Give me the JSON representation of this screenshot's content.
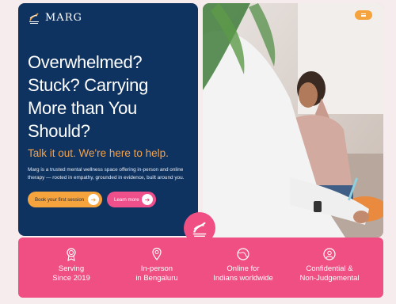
{
  "brand": {
    "name": "MARG"
  },
  "hero": {
    "headline": "Overwhelmed? Stuck? Carrying More than You Should?",
    "tagline": "Talk it out. We're here to help.",
    "description": "Marg is a trusted mental wellness space offering in-person and online therapy — rooted in empathy, grounded in evidence, built around you.",
    "primary_cta": "Book your first session",
    "secondary_cta": "Learn more"
  },
  "features": [
    {
      "icon": "award-ribbon-icon",
      "line1": "Serving",
      "line2": "Since 2019"
    },
    {
      "icon": "map-pin-icon",
      "line1": "In-person",
      "line2": "in Bengaluru"
    },
    {
      "icon": "globe-icon",
      "line1": "Online for",
      "line2": "Indians worldwide"
    },
    {
      "icon": "shield-user-icon",
      "line1": "Confidential &",
      "line2": "Non-Judgemental"
    }
  ],
  "colors": {
    "navy": "#0f3360",
    "orange": "#f5a33c",
    "pink": "#ef4f82",
    "background": "#f6ecee"
  }
}
